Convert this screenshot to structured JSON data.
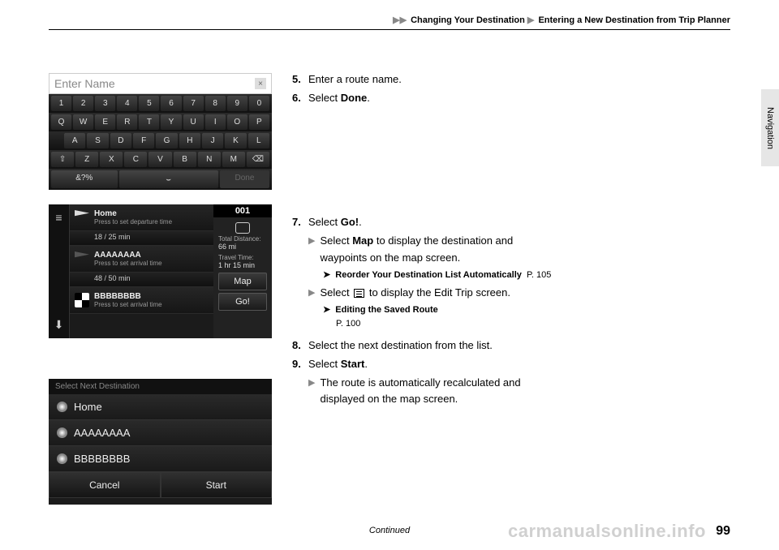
{
  "breadcrumb": {
    "arrows": "▶▶",
    "part1": "Changing Your Destination",
    "sep": "▶",
    "part2": "Entering a New Destination from Trip Planner"
  },
  "side_tab": "Navigation",
  "screen1": {
    "title": "Enter Name",
    "row1": [
      "1",
      "2",
      "3",
      "4",
      "5",
      "6",
      "7",
      "8",
      "9",
      "0"
    ],
    "row2": [
      "Q",
      "W",
      "E",
      "R",
      "T",
      "Y",
      "U",
      "I",
      "O",
      "P"
    ],
    "row3": [
      "A",
      "S",
      "D",
      "F",
      "G",
      "H",
      "J",
      "K",
      "L"
    ],
    "row4_shift": "⇧",
    "row4": [
      "Z",
      "X",
      "C",
      "V",
      "B",
      "N",
      "M"
    ],
    "row4_bksp": "⌫",
    "sym": "&?%",
    "space": "⌣",
    "done": "Done"
  },
  "screen2": {
    "badge": "001",
    "total_dist_label": "Total Distance:",
    "total_dist_value": "66 mi",
    "travel_time_label": "Travel Time:",
    "travel_time_value": "1 hr 15 min",
    "map_btn": "Map",
    "go_btn": "Go!",
    "rows": [
      {
        "title": "Home",
        "sub": "Press to set departure time"
      },
      {
        "thin": "18   / 25 min"
      },
      {
        "title": "AAAAAAAA",
        "sub": "Press to set arrival time"
      },
      {
        "thin": "48   / 50 min"
      },
      {
        "title": "BBBBBBBB",
        "sub": "Press to set arrival time"
      }
    ],
    "side_icons": {
      "menu": "≡",
      "down": "⬇"
    }
  },
  "screen3": {
    "title": "Select Next Destination",
    "items": [
      "Home",
      "AAAAAAAA",
      "BBBBBBBB"
    ],
    "cancel": "Cancel",
    "start": "Start"
  },
  "steps": {
    "s5": {
      "n": "5.",
      "t": "Enter a route name."
    },
    "s6": {
      "n": "6.",
      "pre": "Select ",
      "bold": "Done",
      "post": "."
    },
    "s7": {
      "n": "7.",
      "pre": "Select ",
      "bold": "Go!",
      "post": ".",
      "sub1": {
        "pre": "Select ",
        "bold": "Map",
        "post": " to display the destination and waypoints on the map screen."
      },
      "ref1": {
        "t": "Reorder Your Destination List Automatically",
        "p": "P. 105"
      },
      "sub2": {
        "pre": "Select ",
        "post": " to display the Edit Trip screen."
      },
      "ref2": {
        "t": "Editing the Saved Route",
        "p": "P. 100"
      }
    },
    "s8": {
      "n": "8.",
      "t": "Select the next destination from the list."
    },
    "s9": {
      "n": "9.",
      "pre": "Select ",
      "bold": "Start",
      "post": ".",
      "sub1": {
        "t": "The route is automatically recalculated and displayed on the map screen."
      }
    }
  },
  "footer": {
    "continued": "Continued",
    "page": "99",
    "watermark": "carmanualsonline.info"
  }
}
